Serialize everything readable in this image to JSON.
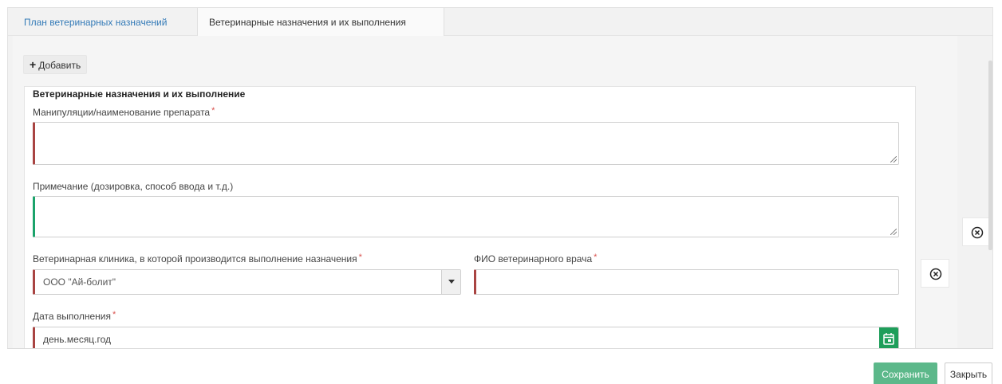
{
  "tabs": [
    {
      "label": "План ветеринарных назначений",
      "active": false
    },
    {
      "label": "Ветеринарные назначения и их выполнения",
      "active": true
    }
  ],
  "toolbar": {
    "add_label": "Добавить"
  },
  "card": {
    "title": "Ветеринарные назначения и их выполнение",
    "fields": {
      "manipulation": {
        "label": "Манипуляции/наименование препарата",
        "required": true,
        "value": ""
      },
      "note": {
        "label": "Примечание (дозировка, способ ввода и т.д.)",
        "required": false,
        "value": ""
      },
      "clinic": {
        "label": "Ветеринарная клиника, в которой производится выполнение назначения",
        "required": true,
        "value": "ООО \"Ай-болит\""
      },
      "doctor": {
        "label": "ФИО ветеринарного врача",
        "required": true,
        "value": ""
      },
      "date": {
        "label": "Дата выполнения",
        "required": true,
        "placeholder": "день.месяц.год"
      }
    }
  },
  "required_mark": "*",
  "footer": {
    "save_label": "Сохранить",
    "close_label": "Закрыть"
  },
  "colors": {
    "link": "#337ab7",
    "invalid": "#a94442",
    "valid": "#1ba36b",
    "save": "#5cb88a",
    "calendar": "#1e9e5a"
  }
}
